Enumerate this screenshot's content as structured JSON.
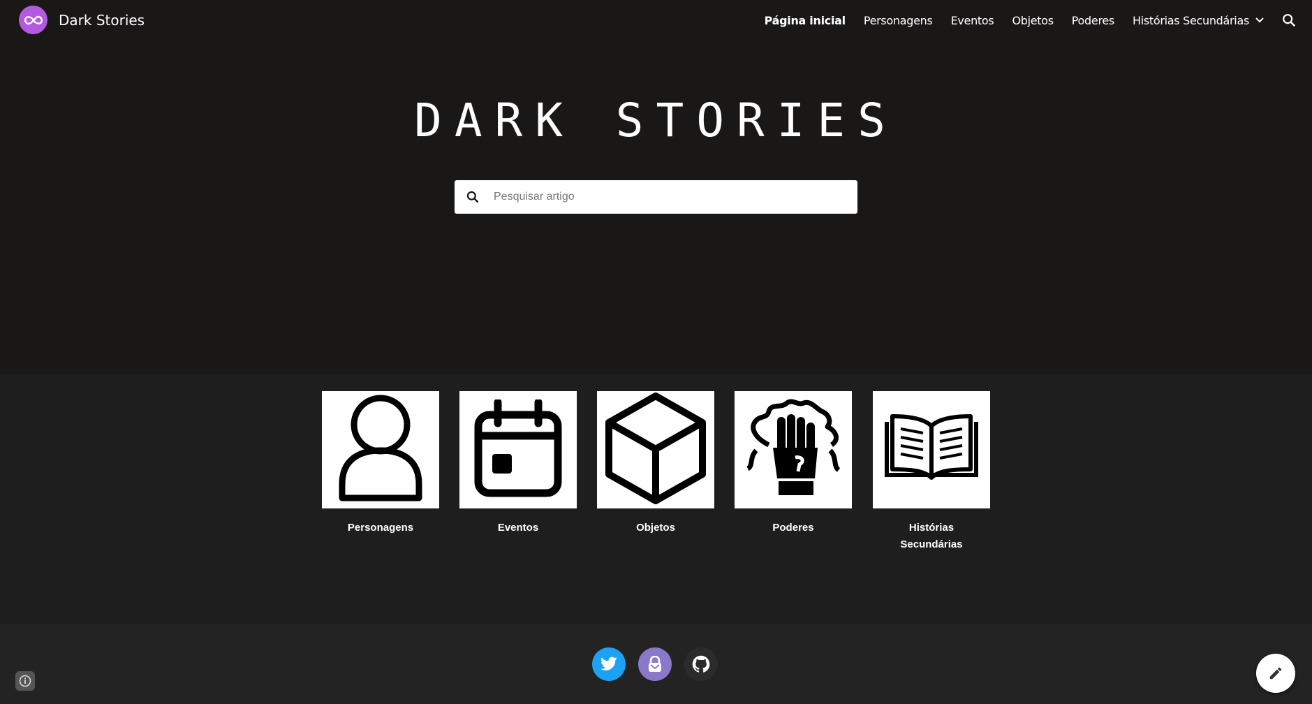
{
  "header": {
    "site_title": "Dark Stories",
    "logo_icon": "infinity-icon",
    "nav": [
      {
        "label": "Página inicial",
        "active": true
      },
      {
        "label": "Personagens"
      },
      {
        "label": "Eventos"
      },
      {
        "label": "Objetos"
      },
      {
        "label": "Poderes"
      },
      {
        "label": "Histórias Secundárias",
        "has_dropdown": true
      }
    ],
    "search_icon": "search-icon"
  },
  "hero": {
    "title": "DARK STORIES",
    "search": {
      "placeholder": "Pesquisar artigo",
      "value": ""
    }
  },
  "categories": [
    {
      "label": "Personagens",
      "icon": "person-icon"
    },
    {
      "label": "Eventos",
      "icon": "calendar-icon"
    },
    {
      "label": "Objetos",
      "icon": "cube-icon"
    },
    {
      "label": "Poderes",
      "icon": "power-fist-icon"
    },
    {
      "label": "Histórias Secundárias",
      "icon": "open-book-icon"
    }
  ],
  "footer": {
    "socials": [
      {
        "icon": "twitter-icon",
        "color": "#1da1f2"
      },
      {
        "icon": "protonmail-icon",
        "color": "#8a79c9"
      },
      {
        "icon": "github-icon",
        "color": "#2b2b2b"
      }
    ],
    "info_icon": "info-icon",
    "edit_icon": "pencil-icon"
  },
  "colors": {
    "hero_bg": "#1a1717",
    "body_bg": "#1e1e1e",
    "footer_bg": "#232323",
    "brand_purple": "#b35be0"
  }
}
